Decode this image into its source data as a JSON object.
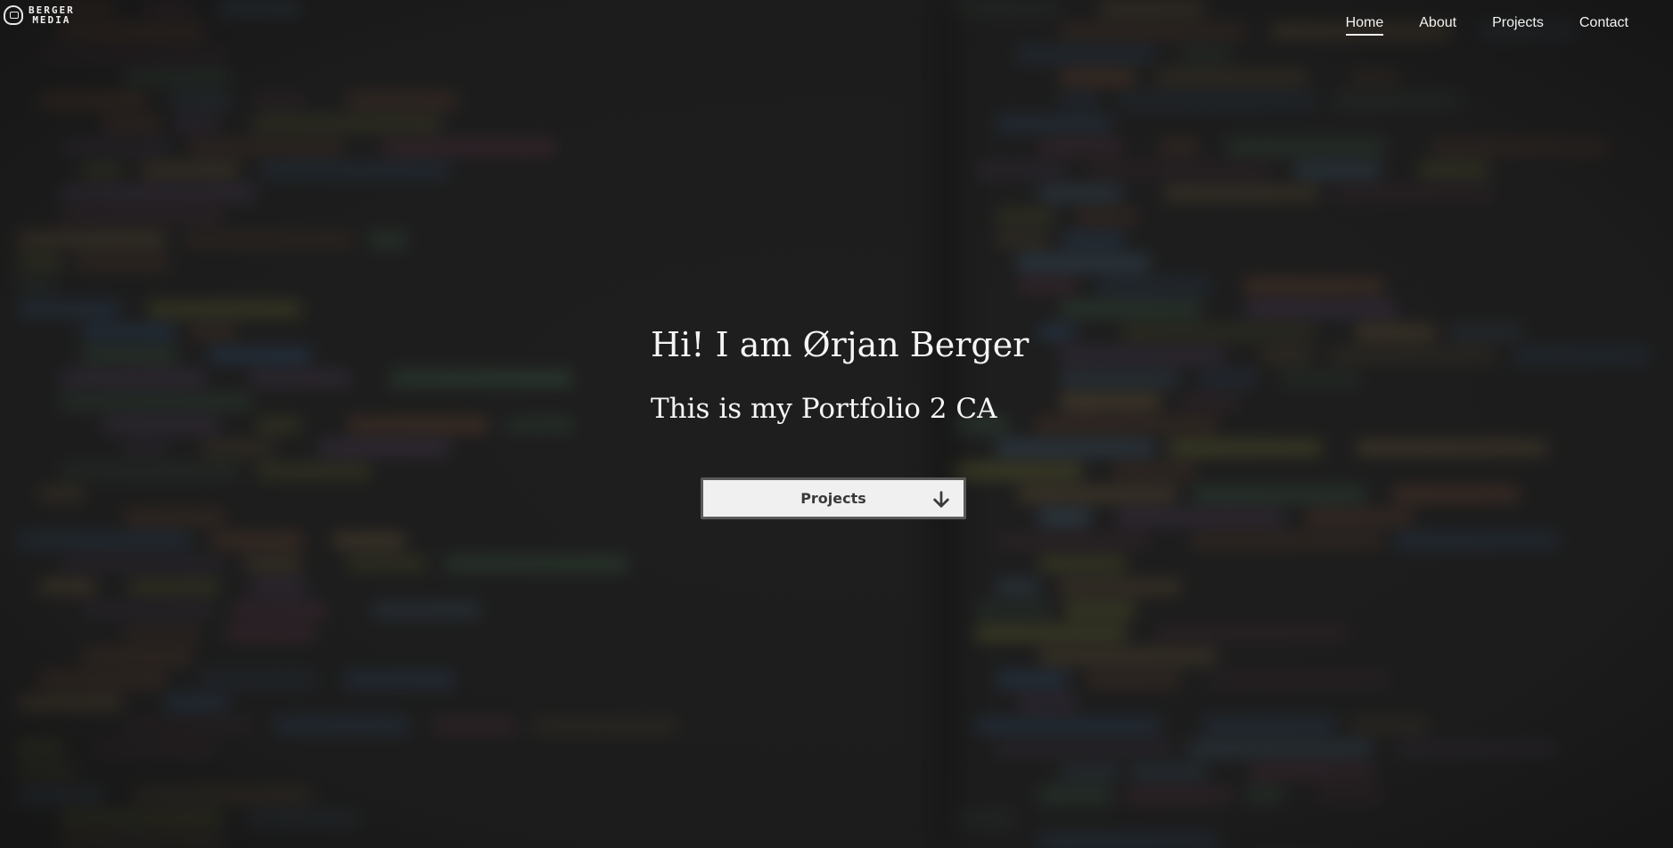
{
  "brand": {
    "line1": "BERGER",
    "line2": "MEDIA"
  },
  "nav": {
    "items": [
      {
        "label": "Home",
        "active": true
      },
      {
        "label": "About",
        "active": false
      },
      {
        "label": "Projects",
        "active": false
      },
      {
        "label": "Contact",
        "active": false
      }
    ]
  },
  "hero": {
    "headline": "Hi! I am Ørjan Berger",
    "subline": "This is my Portfolio 2 CA",
    "cta_label": "Projects",
    "cta_icon": "arrow-down-icon"
  },
  "colors": {
    "background": "#202020",
    "text": "#f5f5f5",
    "button_bg": "#f0f0f0",
    "button_text": "#3a3a3a"
  }
}
